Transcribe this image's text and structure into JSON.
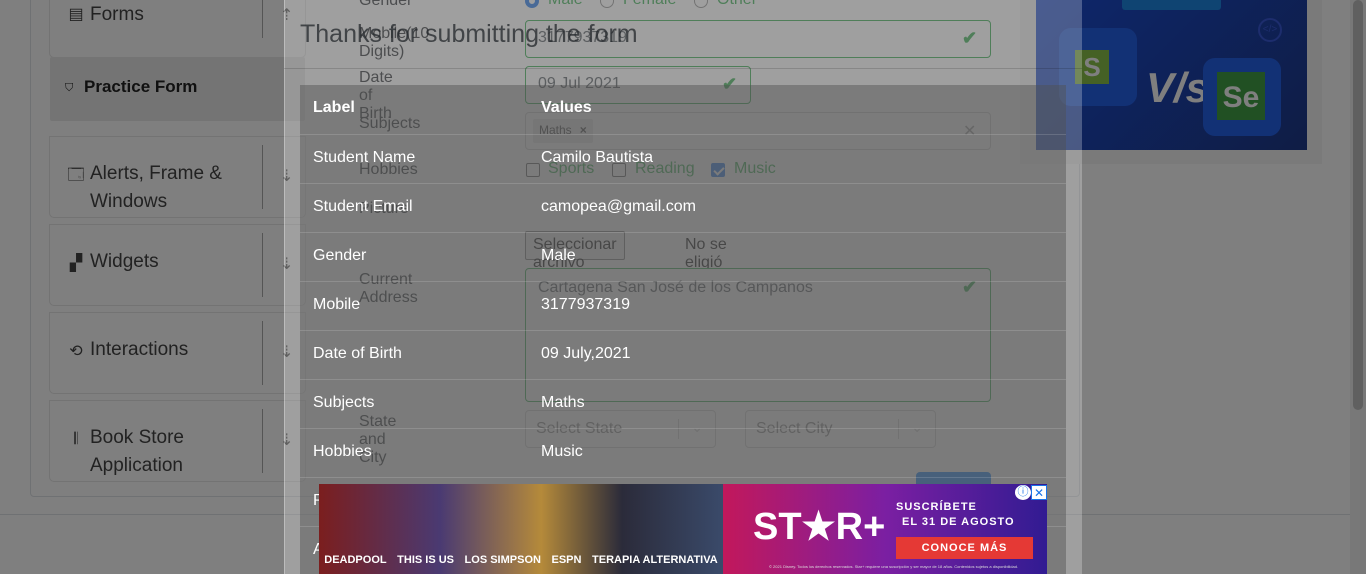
{
  "sidebar": {
    "groups": [
      {
        "label": "Forms",
        "icon": "document-icon"
      },
      {
        "label": "Alerts, Frame &",
        "label2": "Windows",
        "icon": "window-icon"
      },
      {
        "label": "Widgets",
        "icon": "widgets-icon"
      },
      {
        "label": "Interactions",
        "icon": "interactions-icon"
      },
      {
        "label": "Book Store",
        "label2": "Application",
        "icon": "books-icon"
      }
    ],
    "active_item": "Practice Form"
  },
  "form": {
    "gender_label": "Gender",
    "gender_options": [
      "Male",
      "Female",
      "Other"
    ],
    "mobile_label": "Mobile(10 Digits)",
    "mobile_value": "3177937319",
    "dob_label": "Date of Birth",
    "dob_value": "09 Jul 2021",
    "subjects_label": "Subjects",
    "subject_chip": "Maths",
    "hobbies_label": "Hobbies",
    "hobbies": [
      {
        "label": "Sports",
        "checked": false
      },
      {
        "label": "Reading",
        "checked": false
      },
      {
        "label": "Music",
        "checked": true
      }
    ],
    "picture_label": "Picture",
    "file_button": "Seleccionar archivo",
    "file_status": "No se eligió archivo",
    "address_label": "Current Address",
    "address_value": "Cartagena San José de los Campanos",
    "state_city_label": "State and City",
    "state_placeholder": "Select State",
    "city_placeholder": "Select City"
  },
  "modal": {
    "title": "Thanks for submitting the form",
    "header_label": "Label",
    "header_value": "Values",
    "rows": [
      {
        "label": "Student Name",
        "value": "Camilo Bautista"
      },
      {
        "label": "Student Email",
        "value": "camopea@gmail.com"
      },
      {
        "label": "Gender",
        "value": "Male"
      },
      {
        "label": "Mobile",
        "value": "3177937319"
      },
      {
        "label": "Date of Birth",
        "value": "09 July,2021"
      },
      {
        "label": "Subjects",
        "value": "Maths"
      },
      {
        "label": "Hobbies",
        "value": "Music"
      }
    ],
    "partial_rows": [
      "P",
      "A"
    ]
  },
  "promo": {
    "vs_text": "V/s",
    "logo_left": "S",
    "logo_right": "Se"
  },
  "ad": {
    "captions": [
      "DEADPOOL",
      "THIS IS US",
      "LOS SIMPSON",
      "ESPN",
      "TERAPIA ALTERNATIVA"
    ],
    "brand": "ST★R+",
    "line1": "SUSCRÍBETE",
    "line2": "EL 31 DE AGOSTO",
    "cta": "CONOCE MÁS",
    "fine_print": "© 2021 Disney. Todos los derechos reservados. Star+ requiere una suscripción y ser mayor de 18 años. Contenidos sujetos a disponibilidad."
  }
}
